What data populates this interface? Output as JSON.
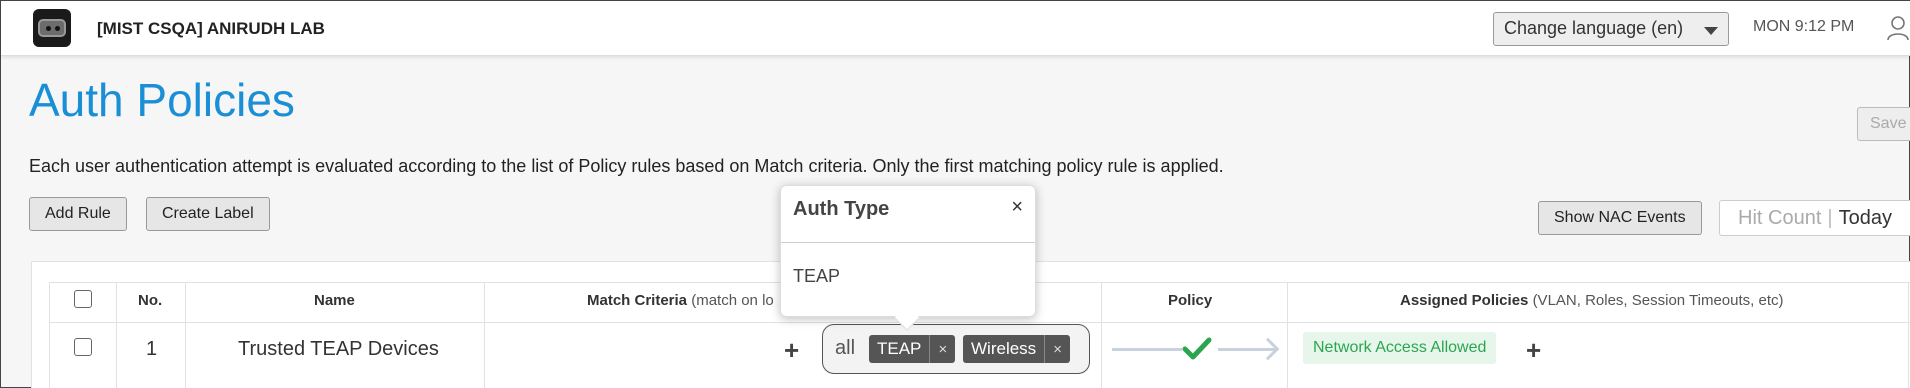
{
  "header": {
    "org_name": "[MIST CSQA] ANIRUDH LAB",
    "language_select": "Change language (en)",
    "clock": "MON 9:12 PM"
  },
  "page": {
    "title": "Auth Policies",
    "save_label": "Save",
    "description": "Each user authentication attempt is evaluated according to the list of Policy rules based on Match criteria. Only the first matching policy rule is applied."
  },
  "toolbar": {
    "add_rule": "Add Rule",
    "create_label": "Create Label",
    "show_nac_events": "Show NAC Events",
    "hit_count": "Hit Count",
    "hit_count_separator": "|",
    "hit_count_period": "Today"
  },
  "table": {
    "columns": {
      "no": "No.",
      "name": "Name",
      "match_criteria": "Match Criteria",
      "match_criteria_sub": "(match on lo",
      "policy": "Policy",
      "assigned_policies": "Assigned Policies",
      "assigned_policies_sub": "(VLAN, Roles, Session Timeouts, etc)"
    },
    "rows": [
      {
        "no": "1",
        "name": "Trusted TEAP Devices",
        "match_mode": "all",
        "tags": [
          "TEAP",
          "Wireless"
        ],
        "assigned_policy": "Network Access Allowed"
      }
    ]
  },
  "popover": {
    "title": "Auth Type",
    "close": "×",
    "value": "TEAP"
  },
  "icons": {
    "tag_remove": "×",
    "add": "+"
  },
  "colors": {
    "accent": "#1a8fd6",
    "success": "#2ba64f",
    "tag_bg": "#555555"
  }
}
